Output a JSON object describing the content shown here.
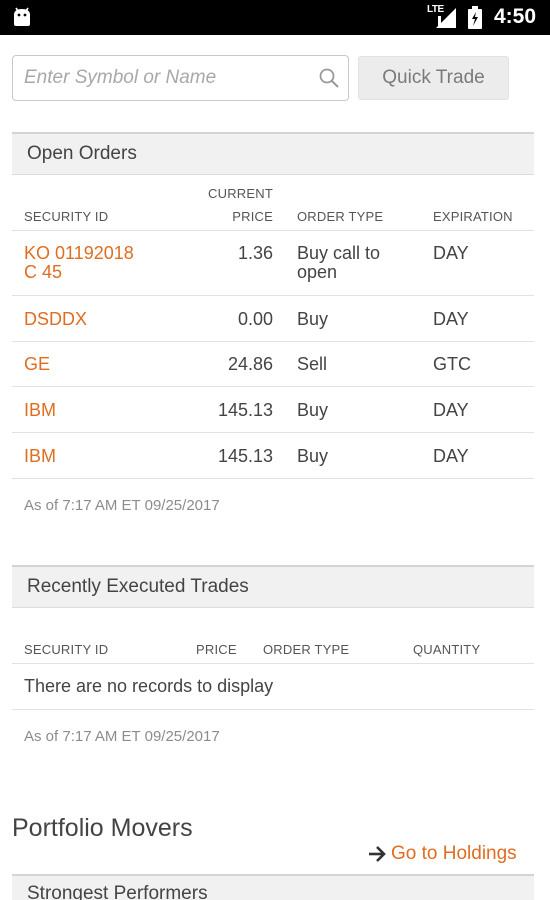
{
  "status_bar": {
    "time": "4:50",
    "network": "LTE"
  },
  "search": {
    "placeholder": "Enter Symbol or Name",
    "value": ""
  },
  "quick_trade_label": "Quick Trade",
  "open_orders": {
    "title": "Open Orders",
    "columns": {
      "security_id": "SECURITY ID",
      "current": "CURRENT",
      "price": "PRICE",
      "order_type": "ORDER TYPE",
      "expiration": "EXPIRATION"
    },
    "rows": [
      {
        "security_line1": "KO 01192018",
        "security_line2": "C 45",
        "price": "1.36",
        "type_line1": "Buy call to",
        "type_line2": "open",
        "expiration": "DAY"
      },
      {
        "security_line1": "DSDDX",
        "security_line2": "",
        "price": "0.00",
        "type_line1": "Buy",
        "type_line2": "",
        "expiration": "DAY"
      },
      {
        "security_line1": "GE",
        "security_line2": "",
        "price": "24.86",
        "type_line1": "Sell",
        "type_line2": "",
        "expiration": "GTC"
      },
      {
        "security_line1": "IBM",
        "security_line2": "",
        "price": "145.13",
        "type_line1": "Buy",
        "type_line2": "",
        "expiration": "DAY"
      },
      {
        "security_line1": "IBM",
        "security_line2": "",
        "price": "145.13",
        "type_line1": "Buy",
        "type_line2": "",
        "expiration": "DAY"
      }
    ],
    "as_of": "As of 7:17 AM ET 09/25/2017"
  },
  "recent_trades": {
    "title": "Recently Executed Trades",
    "columns": {
      "security_id": "SECURITY ID",
      "price": "PRICE",
      "order_type": "ORDER TYPE",
      "quantity": "QUANTITY"
    },
    "empty_message": "There are no records to display",
    "as_of": "As of 7:17 AM ET 09/25/2017"
  },
  "portfolio_movers": {
    "title": "Portfolio Movers",
    "holdings_link": "Go to Holdings",
    "strongest_title": "Strongest Performers"
  },
  "colors": {
    "accent": "#e06d20",
    "header_bg": "#f1f1f1"
  },
  "icons": [
    "android-icon",
    "signal-icon",
    "battery-icon",
    "search-icon",
    "arrow-right-icon"
  ]
}
